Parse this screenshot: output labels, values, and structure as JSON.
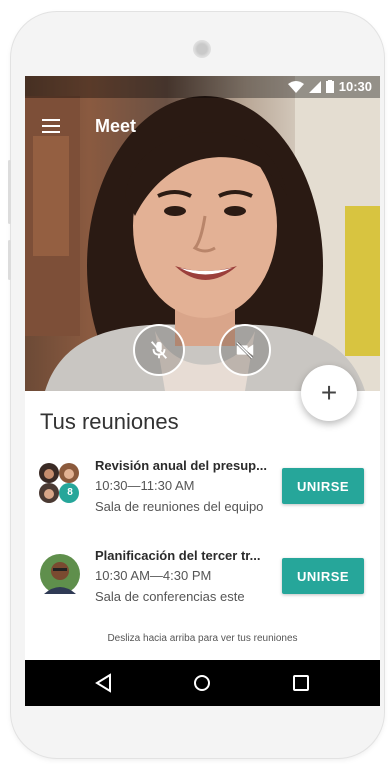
{
  "status_bar": {
    "time": "10:30"
  },
  "app_bar": {
    "title": "Meet"
  },
  "video": {
    "mic_icon": "mic-off-icon",
    "camera_icon": "videocam-off-icon"
  },
  "fab": {
    "label": "+"
  },
  "meetings_section": {
    "title": "Tus reuniones",
    "meetings": [
      {
        "title": "Revisión anual del presup...",
        "time": "10:30—11:30 AM",
        "room": "Sala de reuniones del equipo",
        "extra_count": "8",
        "join_label": "UNIRSE"
      },
      {
        "title": "Planificación del tercer tr...",
        "time": "10:30 AM—4:30 PM",
        "room": "Sala de conferencias este",
        "join_label": "UNIRSE"
      }
    ],
    "hint": "Desliza hacia arriba para ver tus reuniones"
  },
  "colors": {
    "accent": "#26a69a",
    "navbar": "#000000"
  }
}
